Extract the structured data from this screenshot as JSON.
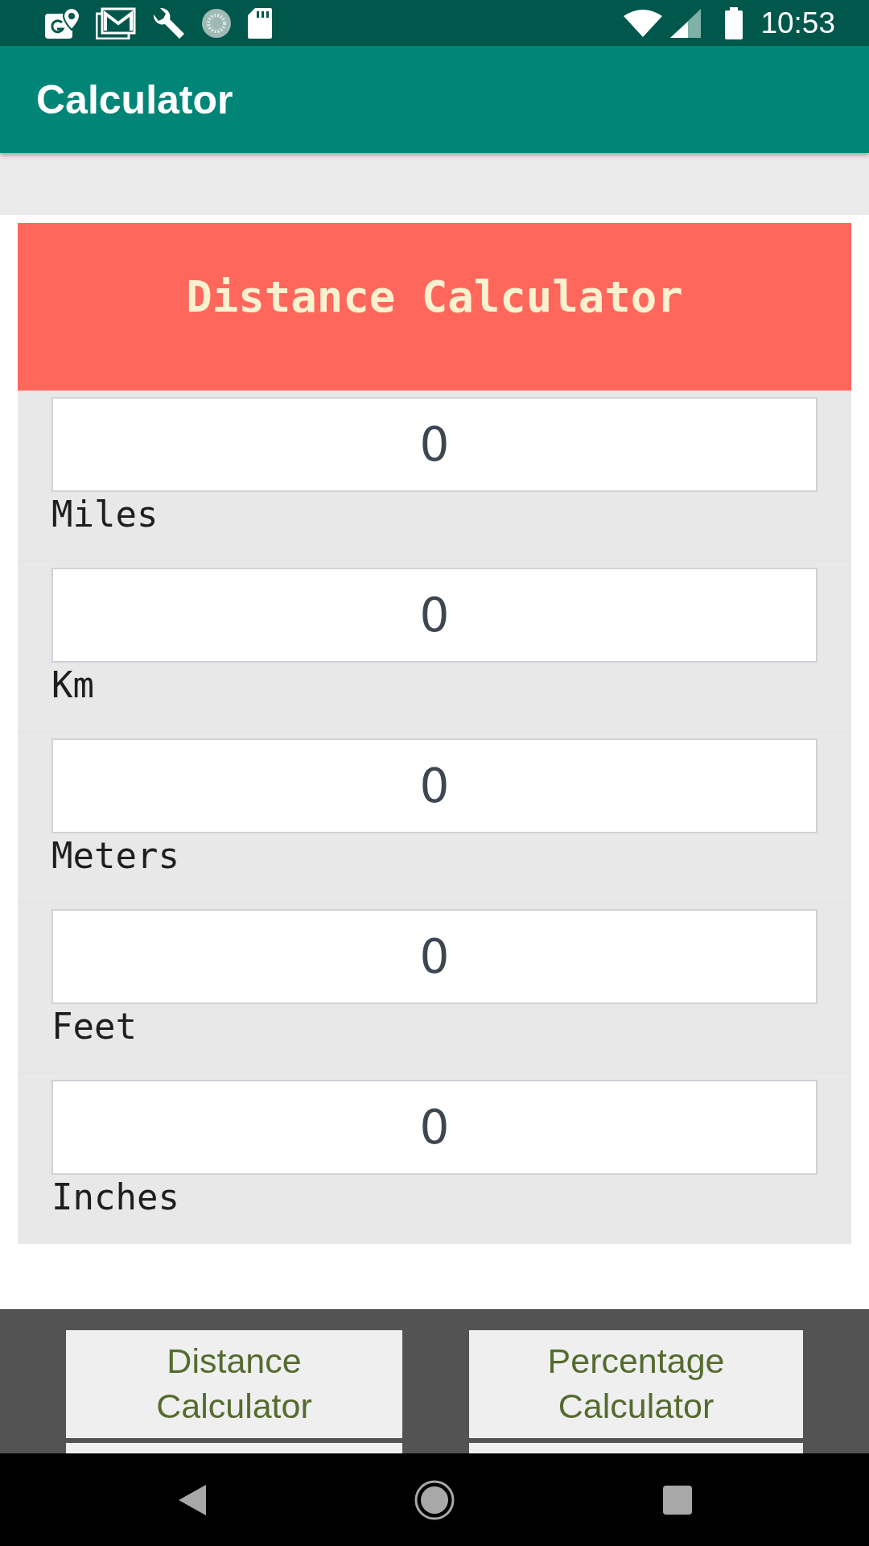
{
  "status_bar": {
    "time": "10:53"
  },
  "app_bar": {
    "title": "Calculator"
  },
  "converter": {
    "title": "Distance Calculator",
    "fields": [
      {
        "label": "Miles",
        "value": "0"
      },
      {
        "label": "Km",
        "value": "0"
      },
      {
        "label": "Meters",
        "value": "0"
      },
      {
        "label": "Feet",
        "value": "0"
      },
      {
        "label": "Inches",
        "value": "0"
      }
    ]
  },
  "menu_buttons": [
    {
      "kind": "labeled",
      "label": "Distance Calculator"
    },
    {
      "kind": "labeled",
      "label": "Percentage Calculator"
    },
    {
      "kind": "cut"
    },
    {
      "kind": "cut"
    }
  ]
}
